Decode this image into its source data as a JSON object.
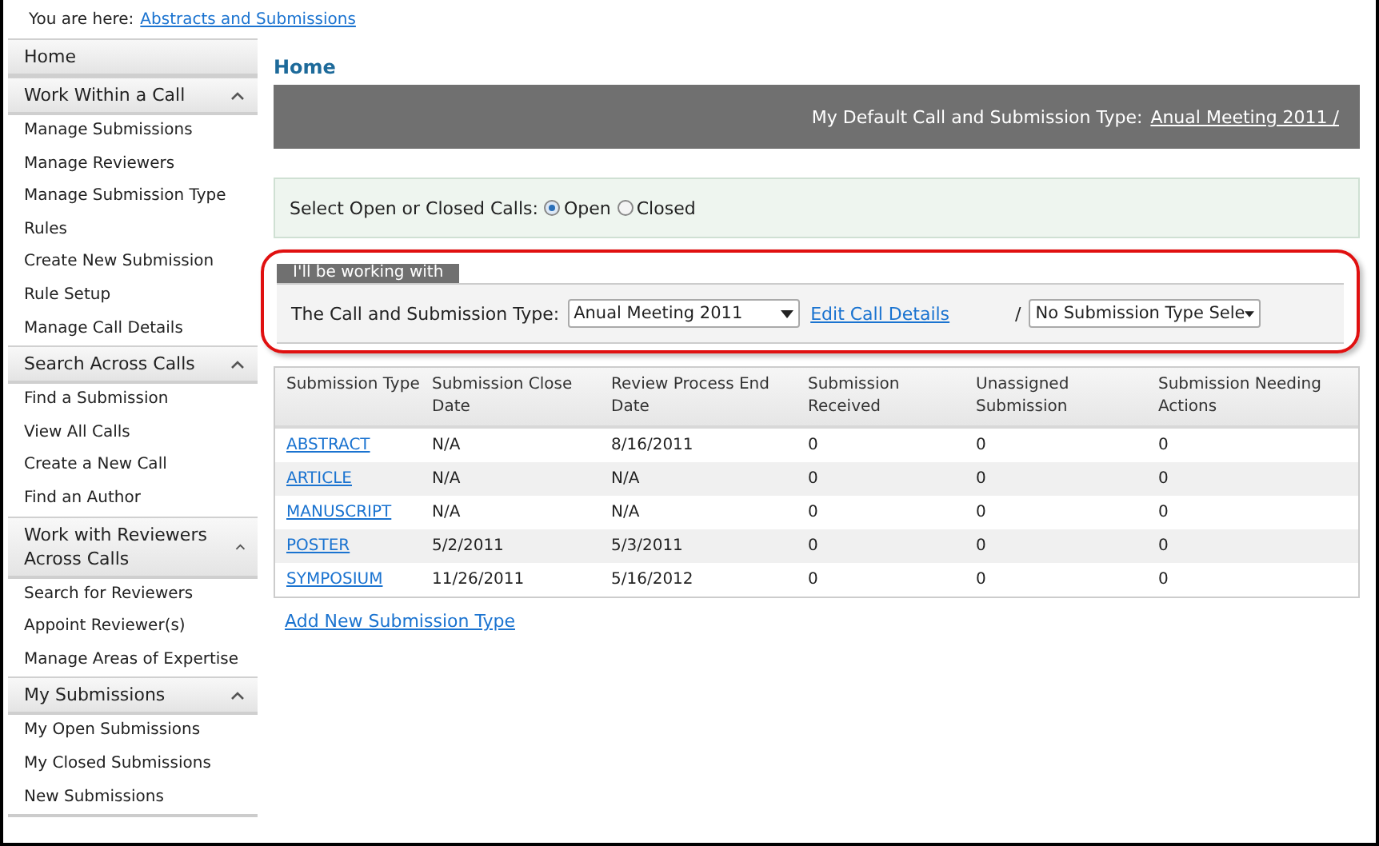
{
  "breadcrumb": {
    "label": "You are here:",
    "link": "Abstracts and Submissions"
  },
  "sidebar": {
    "sections": [
      {
        "title": "Home",
        "kind": "link"
      },
      {
        "title": "Work Within a Call",
        "kind": "section",
        "expanded": true,
        "items": [
          "Manage Submissions",
          "Manage Reviewers",
          "Manage Submission Type",
          "Rules",
          "Create New Submission",
          "Rule Setup",
          "Manage Call Details"
        ]
      },
      {
        "title": "Search Across Calls",
        "kind": "section",
        "expanded": true,
        "items": [
          "Find a Submission",
          "View All Calls",
          "Create a New Call",
          "Find an Author"
        ]
      },
      {
        "title": "Work with Reviewers Across Calls",
        "kind": "section",
        "expanded": true,
        "items": [
          "Search for Reviewers",
          "Appoint Reviewer(s)",
          "Manage Areas of Expertise"
        ]
      },
      {
        "title": "My Submissions",
        "kind": "section",
        "expanded": true,
        "items": [
          "My Open Submissions",
          "My Closed Submissions",
          "New Submissions"
        ]
      }
    ]
  },
  "page_title": "Home",
  "banner": {
    "label": "My Default Call and Submission Type:",
    "link": "Anual Meeting 2011 /"
  },
  "call_filter": {
    "label": "Select Open or Closed Calls:",
    "options": [
      {
        "label": "Open",
        "selected": true
      },
      {
        "label": "Closed",
        "selected": false
      }
    ]
  },
  "working_with": {
    "tab": "I'll be working with",
    "highlighted": true,
    "label": "The Call and Submission Type:",
    "call_select": "Anual Meeting 2011",
    "edit_link": "Edit Call Details",
    "separator": "/",
    "type_select": "No Submission Type Sele"
  },
  "table": {
    "columns": [
      "Submission Type",
      "Submission Close Date",
      "Review Process End Date",
      "Submission Received",
      "Unassigned Submission",
      "Submission Needing Actions"
    ],
    "rows": [
      [
        "ABSTRACT",
        "N/A",
        "8/16/2011",
        "0",
        "0",
        "0"
      ],
      [
        "ARTICLE",
        "N/A",
        "N/A",
        "0",
        "0",
        "0"
      ],
      [
        "MANUSCRIPT",
        "N/A",
        "N/A",
        "0",
        "0",
        "0"
      ],
      [
        "POSTER",
        "5/2/2011",
        "5/3/2011",
        "0",
        "0",
        "0"
      ],
      [
        "SYMPOSIUM",
        "11/26/2011",
        "5/16/2012",
        "0",
        "0",
        "0"
      ]
    ]
  },
  "add_link": "Add New Submission Type"
}
